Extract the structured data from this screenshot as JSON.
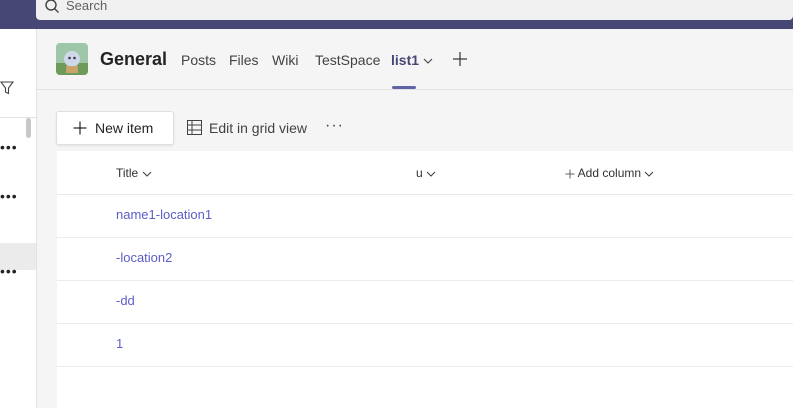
{
  "search": {
    "placeholder": "Search"
  },
  "channel": {
    "name": "General"
  },
  "tabs": [
    {
      "label": "Posts"
    },
    {
      "label": "Files"
    },
    {
      "label": "Wiki"
    },
    {
      "label": "TestSpace"
    },
    {
      "label": "list1",
      "active": true
    }
  ],
  "toolbar": {
    "new_item_label": "New item",
    "edit_grid_label": "Edit in grid view",
    "more_label": "···"
  },
  "list": {
    "columns": [
      "Title",
      "u",
      "Add column"
    ],
    "rows": [
      {
        "title": "name1-location1"
      },
      {
        "title": "-location2"
      },
      {
        "title": "-dd"
      },
      {
        "title": "1"
      }
    ]
  },
  "left_pane": {
    "more_label": "•••"
  },
  "colors": {
    "brand": "#464775",
    "accent": "#6264a7",
    "link": "#5b5fc7"
  }
}
